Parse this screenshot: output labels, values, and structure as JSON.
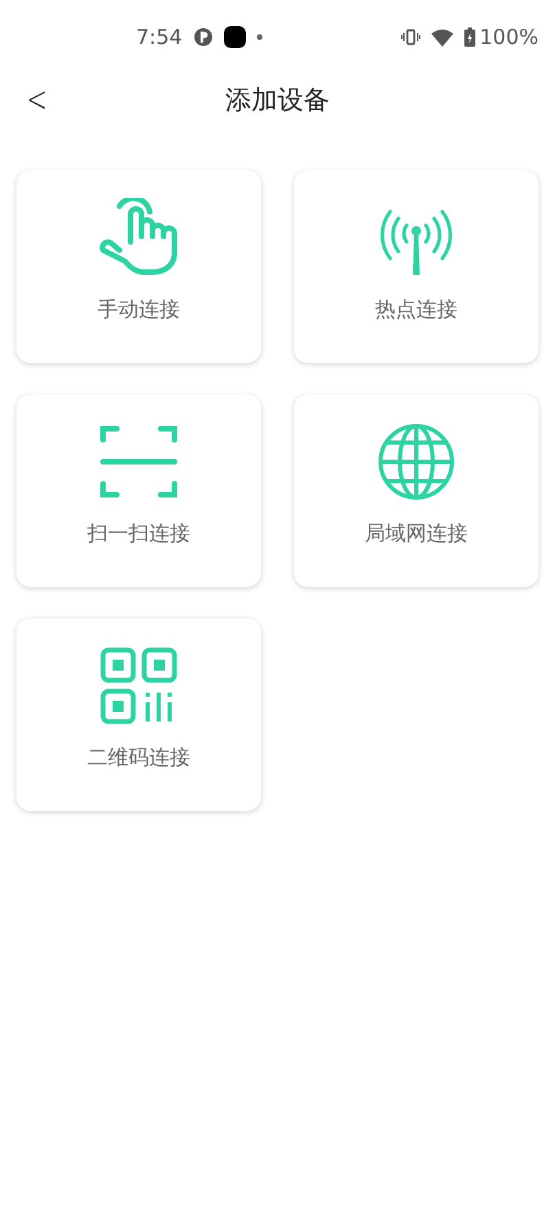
{
  "status_bar": {
    "time": "7:54",
    "battery": "100%"
  },
  "header": {
    "back": "<",
    "title": "添加设备"
  },
  "options": [
    {
      "kind": "hand",
      "label": "手动连接"
    },
    {
      "kind": "antenna",
      "label": "热点连接"
    },
    {
      "kind": "scan",
      "label": "扫一扫连接"
    },
    {
      "kind": "globe",
      "label": "局域网连接"
    },
    {
      "kind": "qrcode",
      "label": "二维码连接"
    }
  ]
}
